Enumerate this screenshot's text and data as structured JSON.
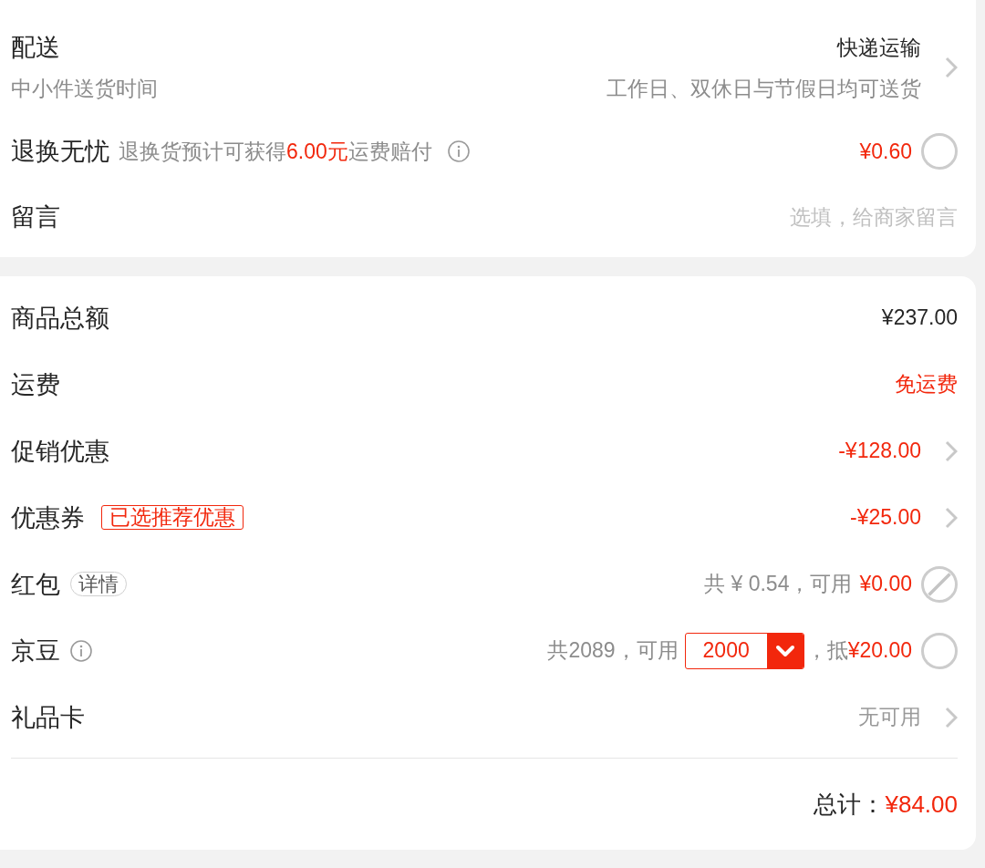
{
  "delivery": {
    "label": "配送",
    "method": "快递运输",
    "time_label": "中小件送货时间",
    "time_note": "工作日、双休日与节假日均可送货"
  },
  "return_service": {
    "label": "退换无忧",
    "description": "退换货预计可获得**6.00元**运费赔付",
    "price": "¥0.60",
    "checked": false
  },
  "message": {
    "label": "留言",
    "placeholder": "选填，给商家留言"
  },
  "summary": {
    "rows": [
      {
        "kind": "value",
        "label": "商品总额",
        "value": "¥237.00",
        "color": "#262626"
      },
      {
        "kind": "value",
        "label": "运费",
        "value": "免运费",
        "color": "#f2270c"
      },
      {
        "kind": "link",
        "label": "促销优惠",
        "value": "-¥128.00",
        "color": "#f2270c"
      },
      {
        "kind": "link",
        "label": "优惠券",
        "badge": {
          "kind": "tag",
          "text": "已选推荐优惠"
        },
        "value": "-¥25.00",
        "color": "#f2270c"
      },
      {
        "kind": "toggle",
        "label": "红包",
        "badge": {
          "kind": "pill",
          "text": "详情"
        },
        "hint": "共 ¥ 0.54，可用",
        "value": "¥0.00",
        "color": "#f2270c",
        "checked": false,
        "disabled": true
      },
      {
        "kind": "select",
        "label": "京豆",
        "badge": {
          "kind": "info"
        },
        "hint": "共2089，可用",
        "select": "2000",
        "hint_after": "，抵",
        "value": "¥20.00",
        "color": "#f2270c",
        "checked": false,
        "disabled": false
      },
      {
        "kind": "link",
        "label": "礼品卡",
        "value": "无可用",
        "color": "#999999"
      }
    ],
    "total": {
      "label": "总计：",
      "value": "¥84.00"
    }
  }
}
